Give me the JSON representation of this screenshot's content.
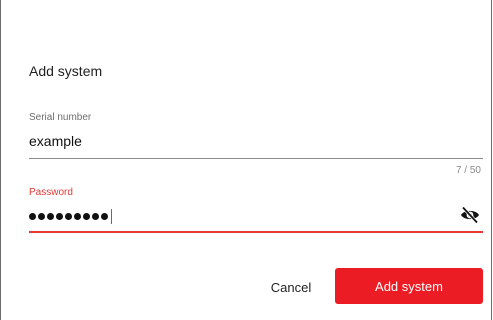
{
  "dialog": {
    "title": "Add system"
  },
  "serial_field": {
    "label": "Serial number",
    "value": "example",
    "counter": "7 / 50"
  },
  "password_field": {
    "label": "Password",
    "masked_length": 9,
    "toggle_icon": "eye-off-icon"
  },
  "actions": {
    "cancel_label": "Cancel",
    "submit_label": "Add system"
  },
  "colors": {
    "accent": "#ec1c24",
    "error": "#e53935"
  }
}
